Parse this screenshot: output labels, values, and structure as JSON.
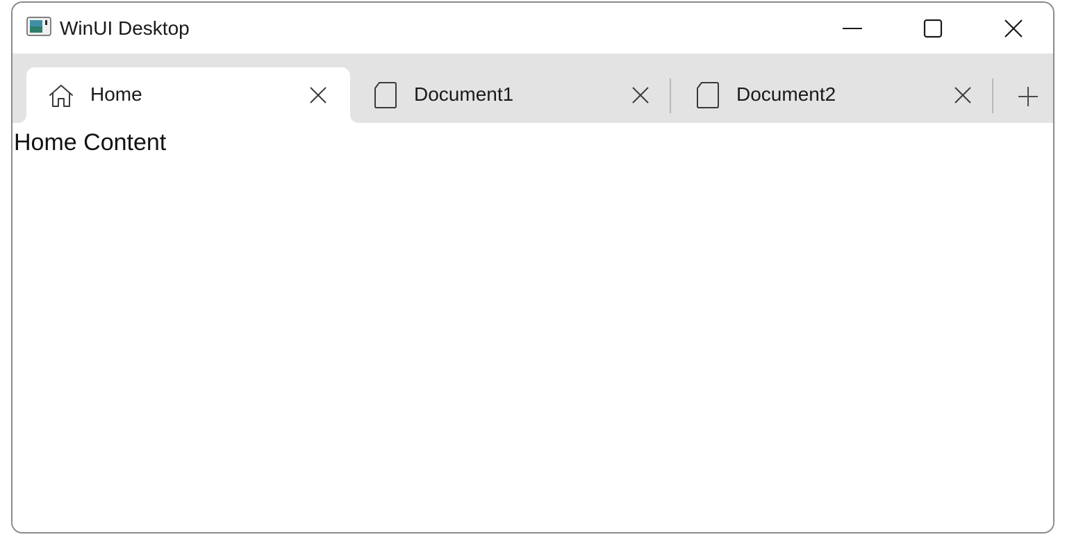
{
  "window": {
    "title": "WinUI Desktop",
    "app_icon": "app-window-icon",
    "caption_buttons": {
      "minimize_icon": "minimize-icon",
      "maximize_icon": "maximize-icon",
      "close_icon": "close-icon"
    }
  },
  "tabs": [
    {
      "label": "Home",
      "icon": "home-icon",
      "selected": true
    },
    {
      "label": "Document1",
      "icon": "document-icon",
      "selected": false
    },
    {
      "label": "Document2",
      "icon": "document-icon",
      "selected": false
    }
  ],
  "add_tab_icon": "plus-icon",
  "content": {
    "text": "Home Content"
  },
  "colors": {
    "tabstrip_background": "#e3e3e3",
    "selected_tab_background": "#ffffff",
    "window_border": "#8a8a8a"
  }
}
